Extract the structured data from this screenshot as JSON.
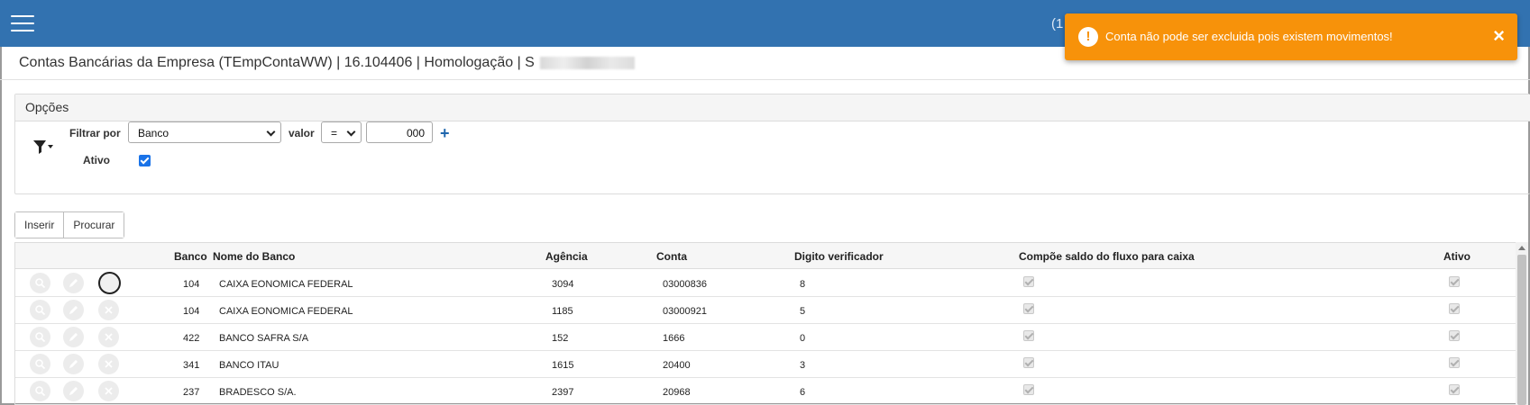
{
  "header": {
    "right_fragment": "(1"
  },
  "toast": {
    "icon": "exclamation-icon",
    "message": "Conta não pode ser excluida pois existem movimentos!",
    "close_label": "×"
  },
  "page": {
    "title": "Contas Bancárias da Empresa (TEmpContaWW) | 16.104406 | Homologação | S"
  },
  "options": {
    "title": "Opções",
    "filter_label": "Filtrar por",
    "filter_field": "Banco",
    "value_label": "valor",
    "operator": "=",
    "value": "000",
    "add_label": "+",
    "active_label": "Ativo",
    "active_checked": true
  },
  "toolbar": {
    "insert_label": "Inserir",
    "search_label": "Procurar"
  },
  "table": {
    "columns": {
      "banco": "Banco",
      "nome": "Nome do Banco",
      "agencia": "Agência",
      "conta": "Conta",
      "digito": "Digito verificador",
      "compoe": "Compõe saldo do fluxo para caixa",
      "ativo": "Ativo"
    },
    "rows": [
      {
        "banco": "104",
        "nome": "CAIXA EONOMICA FEDERAL",
        "agencia": "3094",
        "conta": "03000836",
        "digito": "8"
      },
      {
        "banco": "104",
        "nome": "CAIXA EONOMICA FEDERAL",
        "agencia": "1185",
        "conta": "03000921",
        "digito": "5"
      },
      {
        "banco": "422",
        "nome": "BANCO SAFRA S/A",
        "agencia": "152",
        "conta": "1666",
        "digito": "0"
      },
      {
        "banco": "341",
        "nome": "BANCO ITAU",
        "agencia": "1615",
        "conta": "20400",
        "digito": "3"
      },
      {
        "banco": "237",
        "nome": "BRADESCO S/A.",
        "agencia": "2397",
        "conta": "20968",
        "digito": "6"
      }
    ]
  },
  "colors": {
    "header_bg": "#3272b0",
    "toast_bg": "#f7920a",
    "link_blue": "#1f66ad"
  }
}
